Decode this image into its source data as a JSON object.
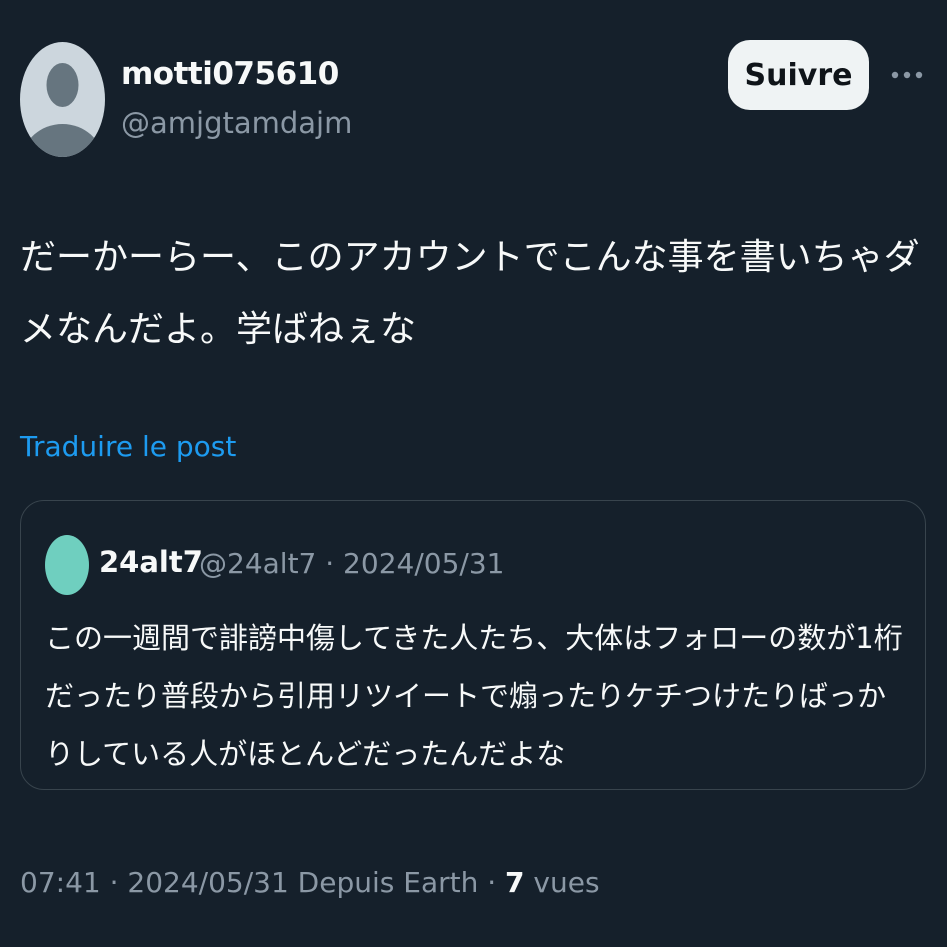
{
  "author": {
    "name": "motti075610",
    "handle": "@amjgtamdajm",
    "avatar_icon": "default-profile-icon"
  },
  "follow_label": "Suivre",
  "more_icon": "ellipsis-icon",
  "post": {
    "text": "だーかーらー、このアカウントでこんな事を書いちゃダメなんだよ。学ばねぇな"
  },
  "translate_label": "Traduire le post",
  "quote": {
    "name": "24alt7",
    "meta": "@24alt7 · 2024/05/31",
    "text": "この一週間で誹謗中傷してきた人たち、大体はフォローの数が1桁だったり普段から引用リツイートで煽ったりケチつけたりばっかりしている人がほとんどだったんだよな",
    "avatar_color": "#6fcfbf"
  },
  "footer": {
    "prefix": "07:41 · 2024/05/31 Depuis Earth · ",
    "views_count": "7",
    "views_label": " vues"
  },
  "colors": {
    "background": "#15202b",
    "text": "#f7f9f9",
    "secondary": "#8b98a5",
    "link": "#1d9bf0",
    "border": "#38444d"
  }
}
